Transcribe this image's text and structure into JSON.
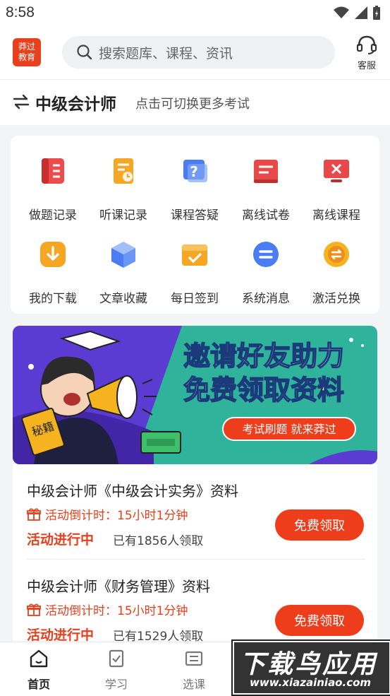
{
  "status_bar": {
    "time": "8:58"
  },
  "header": {
    "logo_text": [
      "莽过",
      "教育"
    ],
    "search_placeholder": "搜索题库、课程、资讯",
    "service_label": "客服"
  },
  "exam": {
    "name": "中级会计师",
    "hint": "点击可切换更多考试"
  },
  "grid": {
    "items": [
      {
        "label": "做题记录",
        "icon": "practice-record-icon",
        "color": "#e94848"
      },
      {
        "label": "听课记录",
        "icon": "listen-record-icon",
        "color": "#f5a623"
      },
      {
        "label": "课程答疑",
        "icon": "course-qa-icon",
        "color": "#4a7df0"
      },
      {
        "label": "离线试卷",
        "icon": "offline-paper-icon",
        "color": "#e94848"
      },
      {
        "label": "离线课程",
        "icon": "offline-course-icon",
        "color": "#e94848"
      },
      {
        "label": "我的下载",
        "icon": "download-icon",
        "color": "#f5a623"
      },
      {
        "label": "文章收藏",
        "icon": "article-favorite-icon",
        "color": "#4a7df0"
      },
      {
        "label": "每日签到",
        "icon": "daily-checkin-icon",
        "color": "#f5a623"
      },
      {
        "label": "系统消息",
        "icon": "system-message-icon",
        "color": "#4a7df0"
      },
      {
        "label": "激活兑换",
        "icon": "activate-exchange-icon",
        "color": "#f5a623"
      }
    ]
  },
  "banner": {
    "headline1": "邀请好友助力",
    "headline2": "免费领取资料",
    "tagline": "考试刷题 就来莽过",
    "book_text": "秘籍"
  },
  "promos": [
    {
      "title": "中级会计师《中级会计实务》资料",
      "countdown": "活动倒计时：15小时1分钟",
      "status": "活动进行中",
      "count": "已有1856人领取",
      "button": "免费领取"
    },
    {
      "title": "中级会计师《财务管理》资料",
      "countdown": "活动倒计时：15小时1分钟",
      "status": "活动进行中",
      "count": "已有1529人领取",
      "button": "免费领取"
    }
  ],
  "tabbar": {
    "tabs": [
      {
        "label": "首页",
        "icon": "home-icon"
      },
      {
        "label": "学习",
        "icon": "study-icon"
      },
      {
        "label": "选课",
        "icon": "select-course-icon"
      }
    ]
  },
  "watermark": {
    "line1": "下载鸟应用",
    "line2": "www.xiazainiao.com"
  },
  "colors": {
    "accent": "#ee3d1b",
    "banner_bg": "#2fb39a",
    "banner_purple": "#5b3bd1"
  }
}
